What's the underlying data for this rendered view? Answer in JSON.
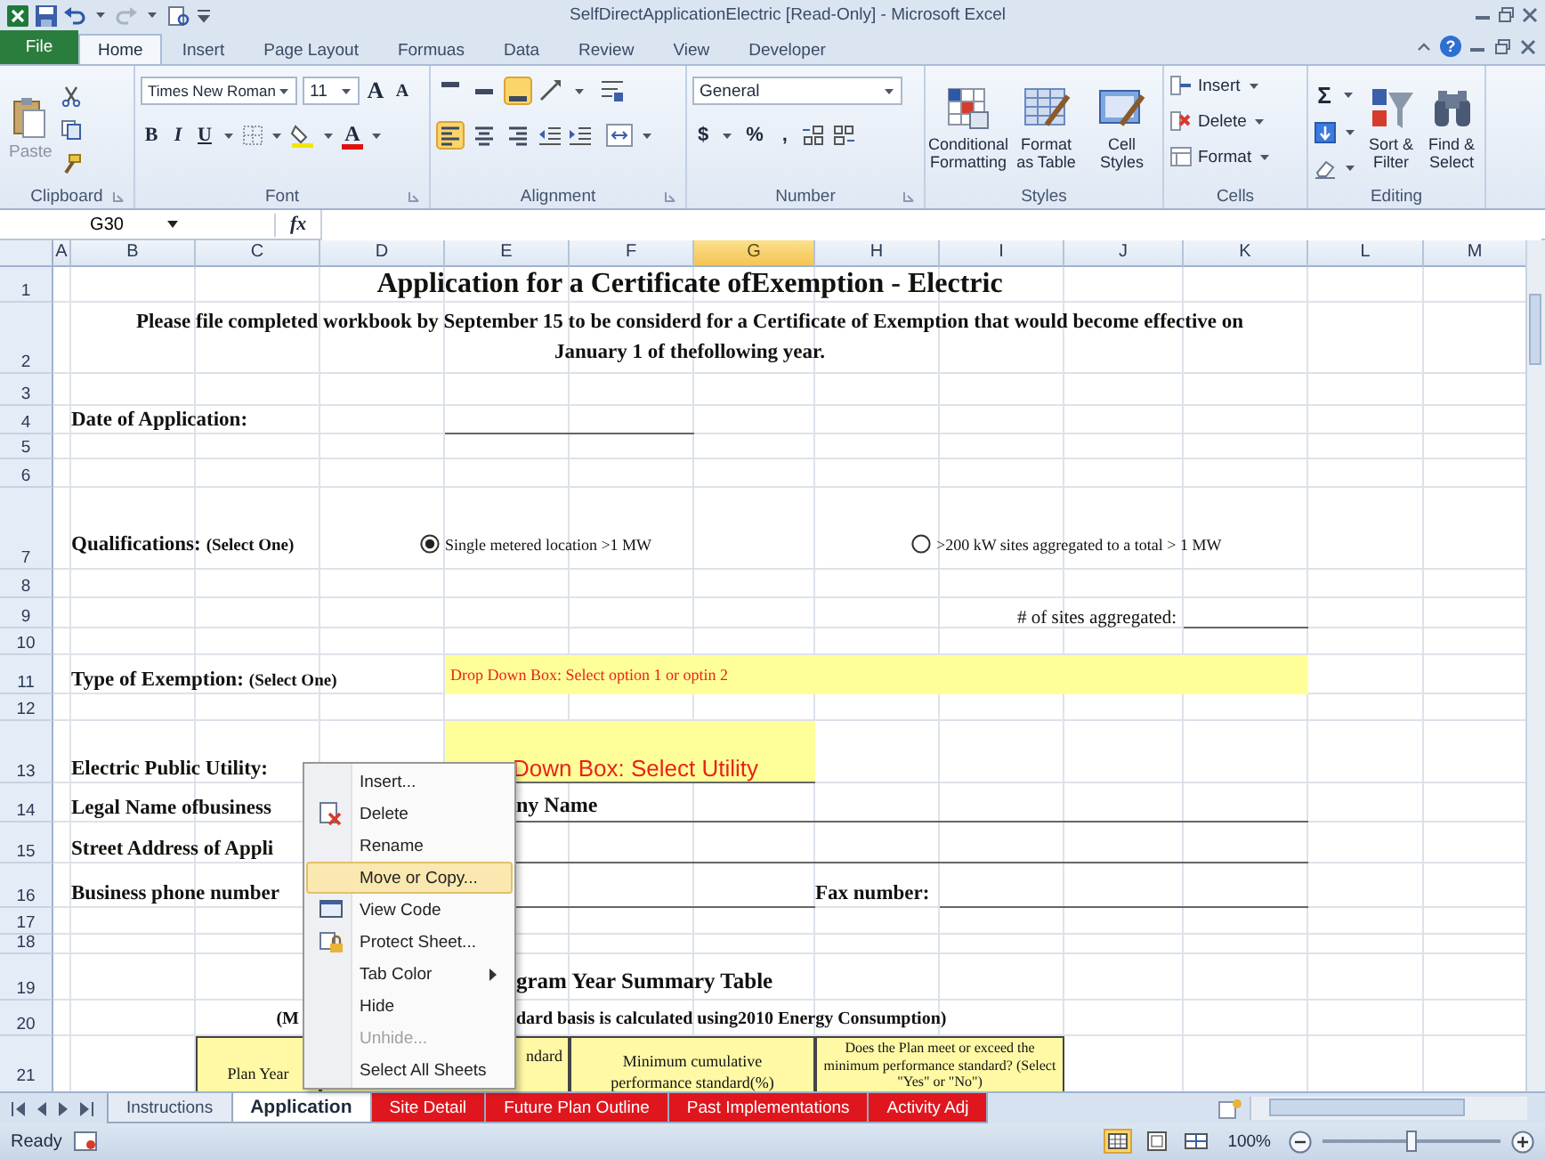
{
  "window": {
    "title": "SelfDirectApplicationElectric [Read-Only] - Microsoft Excel",
    "help": "?"
  },
  "ribbon_tabs": [
    {
      "label": "File",
      "kind": "file",
      "selected": false
    },
    {
      "label": "Home",
      "kind": "tab",
      "selected": true
    },
    {
      "label": "Insert",
      "kind": "tab",
      "selected": false
    },
    {
      "label": "Page Layout",
      "kind": "tab",
      "selected": false
    },
    {
      "label": "Formuas",
      "kind": "tab",
      "selected": false
    },
    {
      "label": "Data",
      "kind": "tab",
      "selected": false
    },
    {
      "label": "Review",
      "kind": "tab",
      "selected": false
    },
    {
      "label": "View",
      "kind": "tab",
      "selected": false
    },
    {
      "label": "Developer",
      "kind": "tab",
      "selected": false
    }
  ],
  "clipboard": {
    "paste": "Paste",
    "label": "Clipboard"
  },
  "font": {
    "family": "Times New Roman",
    "size": "11",
    "grow": "A",
    "shrink": "A",
    "bold": "B",
    "italic": "I",
    "underline": "U",
    "color_glyph": "A",
    "label": "Font"
  },
  "alignment": {
    "label": "Alignment",
    "top_row": [
      {
        "active": false
      },
      {
        "active": false
      },
      {
        "active": true
      }
    ],
    "bottom_row": [
      {
        "active": true
      },
      {
        "active": false
      },
      {
        "active": false
      }
    ]
  },
  "number": {
    "format": "General",
    "currency": "$",
    "percent": "%",
    "comma": ",",
    "label": "Number"
  },
  "styles": {
    "buttons": [
      "Conditional Formatting",
      "Format as Table",
      "Cell Styles"
    ],
    "label": "Styles"
  },
  "cells": {
    "buttons": [
      "Insert",
      "Delete",
      "Format"
    ],
    "label": "Cells"
  },
  "editing": {
    "sum": "Σ",
    "buttons": [
      "Sort & Filter",
      "Find & Select"
    ],
    "label": "Editing"
  },
  "formula_bar": {
    "name_box": "G30",
    "function_glyph": "fx"
  },
  "columns": [
    {
      "label": "A",
      "selected": false
    },
    {
      "label": "B",
      "selected": false
    },
    {
      "label": "C",
      "selected": false
    },
    {
      "label": "D",
      "selected": false
    },
    {
      "label": "E",
      "selected": false
    },
    {
      "label": "F",
      "selected": false
    },
    {
      "label": "G",
      "selected": true
    },
    {
      "label": "H",
      "selected": false
    },
    {
      "label": "I",
      "selected": false
    },
    {
      "label": "J",
      "selected": false
    },
    {
      "label": "K",
      "selected": false
    },
    {
      "label": "L",
      "selected": false
    },
    {
      "label": "M",
      "selected": false
    }
  ],
  "rows": [
    "1",
    "2",
    "3",
    "4",
    "5",
    "6",
    "7",
    "8",
    "9",
    "10",
    "11",
    "12",
    "13",
    "14",
    "15",
    "16",
    "17",
    "18",
    "19",
    "20",
    "21"
  ],
  "sheet": {
    "title": "Application for a Certificate ofExemption - Electric",
    "notice": "Please file completed workbook by September 15 to be considerd for a Certificate of Exemption that would become effective on January 1 of thefollowing year.",
    "date_label": "Date of Application:",
    "qualifications": {
      "label": "Qualifications:",
      "hint": "(Select One)",
      "options": [
        {
          "label": "Single metered location >1 MW",
          "selected": true
        },
        {
          "label": ">200 kW sites aggregated to a total > 1 MW",
          "selected": false
        }
      ]
    },
    "sites_label": "# of sites aggregated:",
    "exemption": {
      "label": "Type of Exemption:",
      "hint": "(Select One)",
      "dropdown": "Drop Down Box:  Select option 1 or optin 2"
    },
    "utility": {
      "label": "Electric Public Utility:",
      "dropdown": "Down Box: Select Utility"
    },
    "legal_name": {
      "label": "Legal Name ofbusiness",
      "value": "ny Name"
    },
    "street_label": "Street Address of Appli",
    "phone_label": "Business phone number",
    "fax_label": "Fax number:",
    "summary_title": "gram Year Summary Table",
    "summary_note": [
      "(M",
      "dard basis is calculated using2010 Energy Consumption)"
    ],
    "table_headers": [
      "Plan Year",
      "ndard",
      "Minimum cumulative performance standard(%)",
      "Does the Plan meet or exceed the minimum performance standard? (Select \"Yes\" or \"No\")"
    ]
  },
  "context_menu": [
    {
      "label": "Insert...",
      "kind": "plain",
      "selected": false,
      "disabled": false,
      "submenu": false
    },
    {
      "label": "Delete",
      "kind": "delete",
      "selected": false,
      "disabled": false,
      "submenu": false
    },
    {
      "label": "Rename",
      "kind": "plain",
      "selected": false,
      "disabled": false,
      "submenu": false
    },
    {
      "label": "Move or Copy...",
      "kind": "plain",
      "selected": true,
      "disabled": false,
      "submenu": false
    },
    {
      "label": "View Code",
      "kind": "code",
      "selected": false,
      "disabled": false,
      "submenu": false
    },
    {
      "label": "Protect Sheet...",
      "kind": "protect",
      "selected": false,
      "disabled": false,
      "submenu": false
    },
    {
      "label": "Tab Color",
      "kind": "plain",
      "selected": false,
      "disabled": false,
      "submenu": true
    },
    {
      "label": "Hide",
      "kind": "plain",
      "selected": false,
      "disabled": false,
      "submenu": false
    },
    {
      "label": "Unhide...",
      "kind": "plain",
      "selected": false,
      "disabled": true,
      "submenu": false
    },
    {
      "label": "Select All Sheets",
      "kind": "plain",
      "selected": false,
      "disabled": false,
      "submenu": false
    }
  ],
  "sheet_tabs": [
    {
      "label": "Instructions",
      "selected": false
    },
    {
      "label": "Application",
      "selected": true
    },
    {
      "label": "Site Detail",
      "selected": false,
      "color": "#e0161e"
    },
    {
      "label": "Future Plan Outline",
      "selected": false,
      "color": "#e0161e"
    },
    {
      "label": "Past Implementations",
      "selected": false,
      "color": "#e0161e"
    },
    {
      "label": "Activity Adj",
      "selected": false,
      "color": "#e0161e"
    }
  ],
  "status_bar": {
    "state": "Ready",
    "views": [
      {
        "selected": true
      },
      {
        "selected": false
      },
      {
        "selected": false
      }
    ],
    "zoom": "100%",
    "zoom_slider": {
      "level": 0.5
    }
  }
}
